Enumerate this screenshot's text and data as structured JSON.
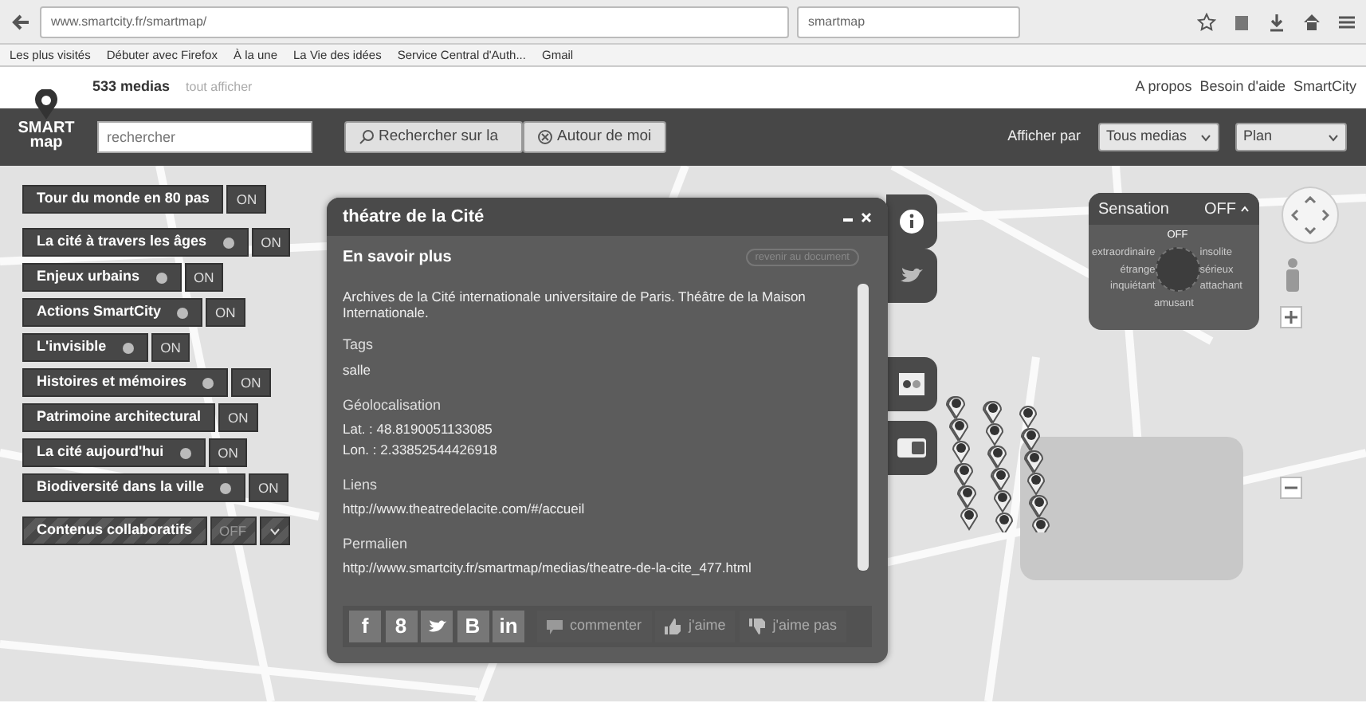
{
  "browser": {
    "url": "www.smartcity.fr/smartmap/",
    "search": "smartmap",
    "bookmarks": [
      "Les plus visités",
      "Débuter avec Firefox",
      "À la une",
      "La Vie des idées",
      "Service Central d'Auth...",
      "Gmail"
    ]
  },
  "header": {
    "count": "533 medias",
    "show_all": "tout afficher",
    "links": [
      "A propos",
      "Besoin d'aide",
      "SmartCity"
    ]
  },
  "logo": {
    "line1": "SMART",
    "line2": "map"
  },
  "toolbar": {
    "search_placeholder": "rechercher",
    "search_button": "Rechercher sur la",
    "nearby_button": "Autour de moi",
    "display_label": "Afficher par",
    "media_select": "Tous medias",
    "map_select": "Plan"
  },
  "layers": [
    {
      "label": "Tour du monde en 80 pas",
      "dot": false,
      "toggle": "ON",
      "on": true,
      "kind": "layer"
    },
    {
      "label": "La cité à travers les âges",
      "dot": true,
      "toggle": "ON",
      "on": true,
      "kind": "layer"
    },
    {
      "label": "Enjeux urbains",
      "dot": true,
      "toggle": "ON",
      "on": true,
      "kind": "layer"
    },
    {
      "label": "Actions SmartCity",
      "dot": true,
      "toggle": "ON",
      "on": true,
      "kind": "layer"
    },
    {
      "label": "L'invisible",
      "dot": true,
      "toggle": "ON",
      "on": true,
      "kind": "layer"
    },
    {
      "label": "Histoires et mémoires",
      "dot": true,
      "toggle": "ON",
      "on": true,
      "kind": "layer"
    },
    {
      "label": "Patrimoine architectural",
      "dot": false,
      "toggle": "ON",
      "on": true,
      "kind": "layer"
    },
    {
      "label": "La cité aujourd'hui",
      "dot": true,
      "toggle": "ON",
      "on": true,
      "kind": "layer"
    },
    {
      "label": "Biodiversité dans la ville",
      "dot": true,
      "toggle": "ON",
      "on": true,
      "kind": "layer"
    },
    {
      "label": "Contenus collaboratifs",
      "dot": false,
      "toggle": "OFF",
      "on": false,
      "kind": "collab"
    }
  ],
  "popup": {
    "title": "théatre de la Cité",
    "heading": "En savoir plus",
    "back_link": "revenir au document",
    "description": "Archives de la Cité internationale universitaire de Paris. Théâtre de la Maison Internationale.",
    "sections": [
      {
        "heading": "Tags",
        "lines": [
          "salle"
        ]
      },
      {
        "heading": "Géolocalisation",
        "lines": [
          "Lat. : 48.8190051133085",
          "Lon. : 2.33852544426918"
        ]
      },
      {
        "heading": "Liens",
        "lines": [
          "http://www.theatredelacite.com/#/accueil"
        ]
      },
      {
        "heading": "Permalien",
        "lines": [
          "http://www.smartcity.fr/smartmap/medias/theatre-de-la-cite_477.html"
        ]
      }
    ],
    "social": [
      {
        "kind": "text",
        "label": "f"
      },
      {
        "kind": "text",
        "label": "8"
      },
      {
        "kind": "bird"
      },
      {
        "kind": "text",
        "label": "B"
      },
      {
        "kind": "text",
        "label": "in"
      }
    ],
    "actions": [
      {
        "kind": "comment",
        "label": "commenter"
      },
      {
        "kind": "like",
        "label": "j'aime"
      },
      {
        "kind": "dislike",
        "label": "j'aime pas"
      }
    ]
  },
  "side_tabs": [
    {
      "kind": "info"
    },
    {
      "kind": "bird"
    },
    {
      "kind": "flickr"
    },
    {
      "kind": "youtube"
    }
  ],
  "sensation": {
    "title": "Sensation",
    "state": "OFF",
    "expanded": true,
    "top": "OFF",
    "left": [
      "extraordinaire",
      "étrange",
      "inquiétant"
    ],
    "right": [
      "insolite",
      "sérieux",
      "attachant"
    ],
    "bottom": "amusant"
  }
}
